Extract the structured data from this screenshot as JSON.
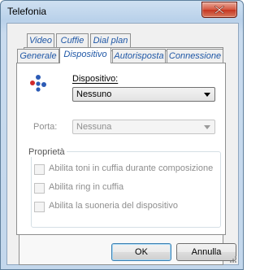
{
  "window": {
    "title": "Telefonia"
  },
  "tabs": {
    "row_back": [
      "Video",
      "Cuffie",
      "Dial plan"
    ],
    "row_front": [
      "Generale",
      "Dispositivo",
      "Autorisposta",
      "Connessione"
    ],
    "active": "Dispositivo"
  },
  "device": {
    "label": "Dispositivo:",
    "value": "Nessuno"
  },
  "port": {
    "label": "Porta:",
    "value": "Nessuna"
  },
  "properties": {
    "title": "Proprietà",
    "options": [
      {
        "label": "Abilita toni in cuffia durante composizione",
        "checked": false
      },
      {
        "label": "Abilita ring in cuffia",
        "checked": false
      },
      {
        "label": "Abilita la suoneria del dispositivo",
        "checked": false
      }
    ]
  },
  "buttons": {
    "ok": "OK",
    "cancel": "Annulla"
  },
  "colors": {
    "tab_text": "#1f57a6",
    "disabled_text": "#8e8e8e"
  }
}
